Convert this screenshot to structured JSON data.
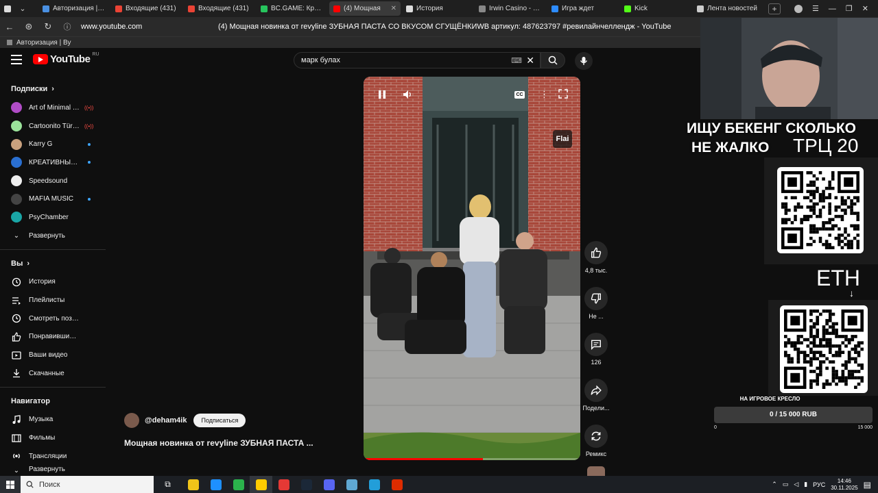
{
  "browser": {
    "tabs": [
      {
        "title": "Авторизация | Ву",
        "color": "#4a90e2"
      },
      {
        "title": "Входящие (431)",
        "color": "#ea4335"
      },
      {
        "title": "Входящие (431)",
        "color": "#ea4335"
      },
      {
        "title": "BC.GAME: Крипто",
        "color": "#27c45d"
      },
      {
        "title": "(4) Мощная",
        "color": "#ff0000",
        "active": true
      },
      {
        "title": "История",
        "color": "#dddddd"
      },
      {
        "title": "Irwin Casino - дост",
        "color": "#888888"
      },
      {
        "title": "Игра ждет",
        "color": "#2d8cff"
      },
      {
        "title": "Kick",
        "color": "#53fc18"
      },
      {
        "title": "Лента новостей",
        "color": "#cccccc"
      }
    ],
    "url": "www.youtube.com",
    "page_title": "(4) Мощная новинка от revyline ЗУБНАЯ ПАСТА СО ВКУСОМ СГУЩЁНКИWB артикул: 487623797 #ревилайнчеллендж - YouTube",
    "bookmark": "Авторизация | Ву"
  },
  "youtube": {
    "logo": "YouTube",
    "logo_region": "RU",
    "search_value": "марк булах"
  },
  "sidebar": {
    "subs_title": "Подписки",
    "channels": [
      {
        "name": "Art of Minimal T...",
        "color": "#b04cc6",
        "badge": "live"
      },
      {
        "name": "Cartoonito Türkiye",
        "color": "#9be39b",
        "badge": "live"
      },
      {
        "name": "Karry G",
        "color": "#c9a17e",
        "badge": "dot"
      },
      {
        "name": "КРЕАТИВНЫЙ ...",
        "color": "#2a6fd1",
        "badge": "dot"
      },
      {
        "name": "Speedsound",
        "color": "#eeeeee",
        "badge": ""
      },
      {
        "name": "MAFIA MUSIC",
        "color": "#444444",
        "badge": "dot"
      },
      {
        "name": "PsyChamber",
        "color": "#1aa6a6",
        "badge": ""
      }
    ],
    "expand": "Развернуть",
    "you_title": "Вы",
    "you_items": [
      "История",
      "Плейлисты",
      "Смотреть позже",
      "Понравившиеся",
      "Ваши видео",
      "Скачанные"
    ],
    "nav_title": "Навигатор",
    "nav_items": [
      "Музыка",
      "Фильмы",
      "Трансляции",
      "Развернуть"
    ]
  },
  "video": {
    "watermark": "Flai",
    "cc": "CC",
    "progress": 0.55,
    "channel": "@deham4ik",
    "subscribe": "Подписаться",
    "title": "Мощная новинка от revyline ЗУБНАЯ ПАСТА ..."
  },
  "actions": {
    "like": "4,8 тыс.",
    "dislike": "Не ...",
    "comments": "126",
    "share": "Подели...",
    "remix": "Ремикс"
  },
  "overlay": {
    "line1": "ИЩУ БЕКЕНГ СКОЛЬКО",
    "line2": "НЕ ЖАЛКО",
    "trc": "ТРЦ 20",
    "eth": "ETH",
    "donate_title": "НА ИГРОВОЕ КРЕСЛО",
    "donate_value": "0 / 15 000 RUB",
    "donate_progress": 0,
    "donate_min": "0",
    "donate_max": "15 000"
  },
  "taskbar": {
    "search": "Поиск",
    "lang": "РУС",
    "time": "14:46",
    "date": "30.11.2025",
    "apps": [
      "#f0c419",
      "#1e90ff",
      "#2bb24c",
      "#ffcc00",
      "#e53935",
      "#1b2838",
      "#5865f2",
      "#5fa8d3",
      "#229ed9",
      "#dd2c00"
    ]
  }
}
